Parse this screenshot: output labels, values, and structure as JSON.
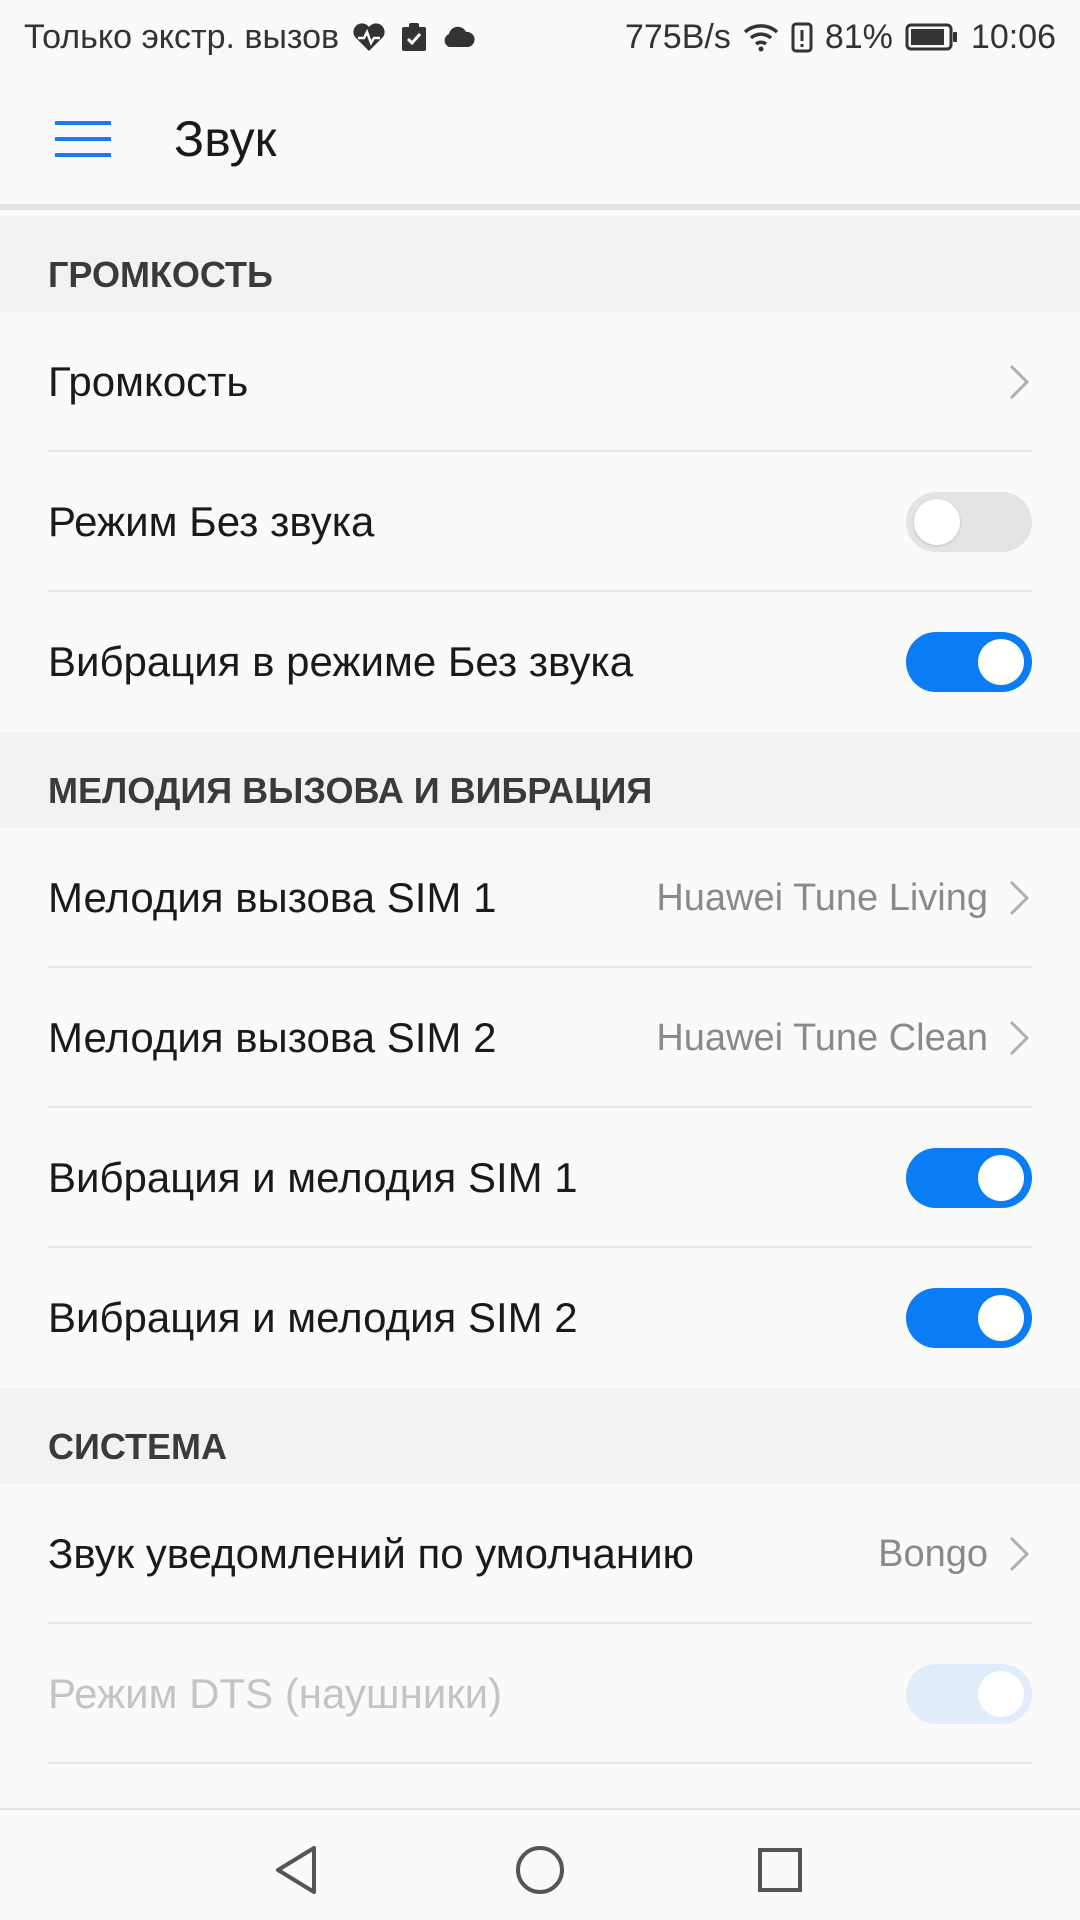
{
  "status_bar": {
    "carrier_text": "Только экстр. вызов",
    "net_speed": "775B/s",
    "battery": "81%",
    "time": "10:06",
    "icons": [
      "heart-rate-icon",
      "clipboard-check-icon",
      "cloud-icon",
      "wifi-icon",
      "battery-saver-icon",
      "battery-icon"
    ]
  },
  "app_bar": {
    "title": "Звук"
  },
  "sections": {
    "volume": {
      "header": "ГРОМКОСТЬ",
      "rows": [
        {
          "label": "Громкость"
        },
        {
          "label": "Режим Без звука",
          "toggle": "off"
        },
        {
          "label": "Вибрация в режиме Без звука",
          "toggle": "on"
        }
      ]
    },
    "ringtone": {
      "header": "МЕЛОДИЯ ВЫЗОВА И ВИБРАЦИЯ",
      "rows": [
        {
          "label": "Мелодия вызова SIM 1",
          "value": "Huawei Tune Living"
        },
        {
          "label": "Мелодия вызова SIM 2",
          "value": "Huawei Tune Clean"
        },
        {
          "label": "Вибрация и мелодия SIM 1",
          "toggle": "on"
        },
        {
          "label": "Вибрация и мелодия SIM 2",
          "toggle": "on"
        }
      ]
    },
    "system": {
      "header": "СИСТЕМА",
      "rows": [
        {
          "label": "Звук уведомлений по умолчанию",
          "value": "Bongo"
        },
        {
          "label": "Режим DTS (наушники)",
          "toggle": "on",
          "disabled": true
        }
      ]
    }
  },
  "nav": {
    "icons": [
      "back-icon",
      "home-icon",
      "recents-icon"
    ]
  },
  "colors": {
    "accent": "#0a7cf4",
    "menu_icon": "#1a7cf0"
  }
}
